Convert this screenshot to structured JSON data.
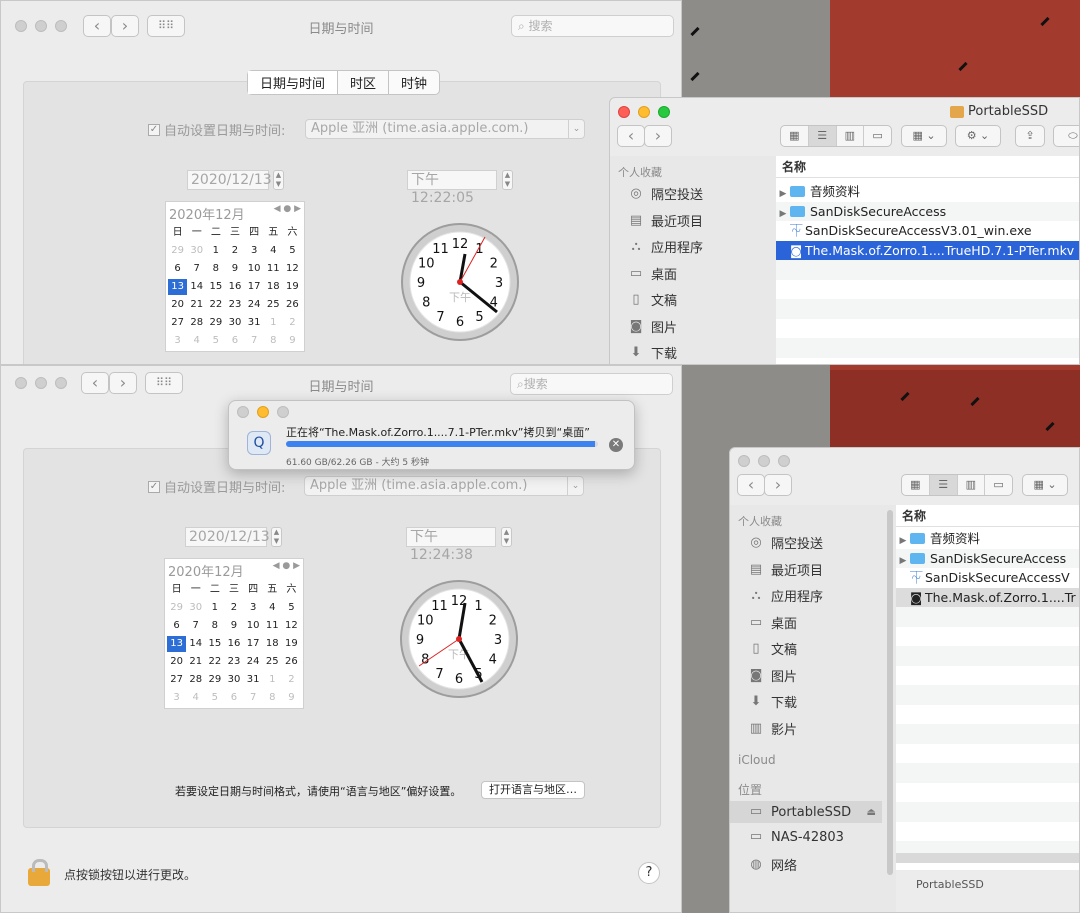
{
  "top": {
    "title": "日期与时间",
    "search_placeholder": "搜索",
    "tabs": [
      "日期与时间",
      "时区",
      "时钟"
    ],
    "auto_label": "自动设置日期与时间:",
    "server": "Apple 亚洲 (time.asia.apple.com.)",
    "date": "2020/12/13",
    "time": "下午12:22:05",
    "cal_title": "2020年12月",
    "clock_label": "下午",
    "clock_numbers": [
      "12",
      "1",
      "2",
      "3",
      "4",
      "5",
      "6",
      "7",
      "8",
      "9",
      "10",
      "11"
    ]
  },
  "bottom": {
    "title": "日期与时间",
    "search_placeholder": "搜索",
    "auto_label": "自动设置日期与时间:",
    "server": "Apple 亚洲 (time.asia.apple.com.)",
    "date": "2020/12/13",
    "time": "下午12:24:38",
    "cal_title": "2020年12月",
    "clock_label": "下午",
    "clock_numbers": [
      "12",
      "1",
      "2",
      "3",
      "4",
      "5",
      "6",
      "7",
      "8",
      "9",
      "10",
      "11"
    ],
    "format_note": "若要设定日期与时间格式，请使用“语言与地区”偏好设置。",
    "open_region_button": "打开语言与地区…",
    "lock_text": "点按锁按钮以进行更改。",
    "help": "?"
  },
  "calendar": {
    "weekdays": [
      "日",
      "一",
      "二",
      "三",
      "四",
      "五",
      "六"
    ],
    "days": [
      "29",
      "30",
      "1",
      "2",
      "3",
      "4",
      "5",
      "6",
      "7",
      "8",
      "9",
      "10",
      "11",
      "12",
      "13",
      "14",
      "15",
      "16",
      "17",
      "18",
      "19",
      "20",
      "21",
      "22",
      "23",
      "24",
      "25",
      "26",
      "27",
      "28",
      "29",
      "30",
      "31",
      "1",
      "2",
      "3",
      "4",
      "5",
      "6",
      "7",
      "8",
      "9"
    ]
  },
  "copy_dialog": {
    "message": "正在将“The.Mask.of.Zorro.1....7.1-PTer.mkv”拷贝到“桌面”",
    "detail": "61.60 GB/62.26 GB - 大约 5 秒钟",
    "progress": 0.99
  },
  "finder1": {
    "title": "PortableSSD",
    "sidebar_head": "个人收藏",
    "sidebar": [
      "隔空投送",
      "最近项目",
      "应用程序",
      "桌面",
      "文稿",
      "图片",
      "下载"
    ],
    "col_name": "名称",
    "files": [
      "音频资料",
      "SanDiskSecureAccess",
      "SanDiskSecureAccessV3.01_win.exe",
      "The.Mask.of.Zorro.1....TrueHD.7.1-PTer.mkv"
    ]
  },
  "finder2": {
    "sidebar_head": "个人收藏",
    "sidebar": [
      "隔空投送",
      "最近项目",
      "应用程序",
      "桌面",
      "文稿",
      "图片",
      "下载",
      "影片"
    ],
    "icloud": "iCloud",
    "locations_head": "位置",
    "locations": [
      "PortableSSD",
      "NAS-42803",
      "网络"
    ],
    "col_name": "名称",
    "files": [
      "音频资料",
      "SanDiskSecureAccess",
      "SanDiskSecureAccessV",
      "The.Mask.of.Zorro.1....Tr"
    ],
    "path_bar": "PortableSSD"
  },
  "colors": {
    "accent": "#2b64d8",
    "progress": "#3c82f0",
    "desk_red": "#a23a2e"
  }
}
